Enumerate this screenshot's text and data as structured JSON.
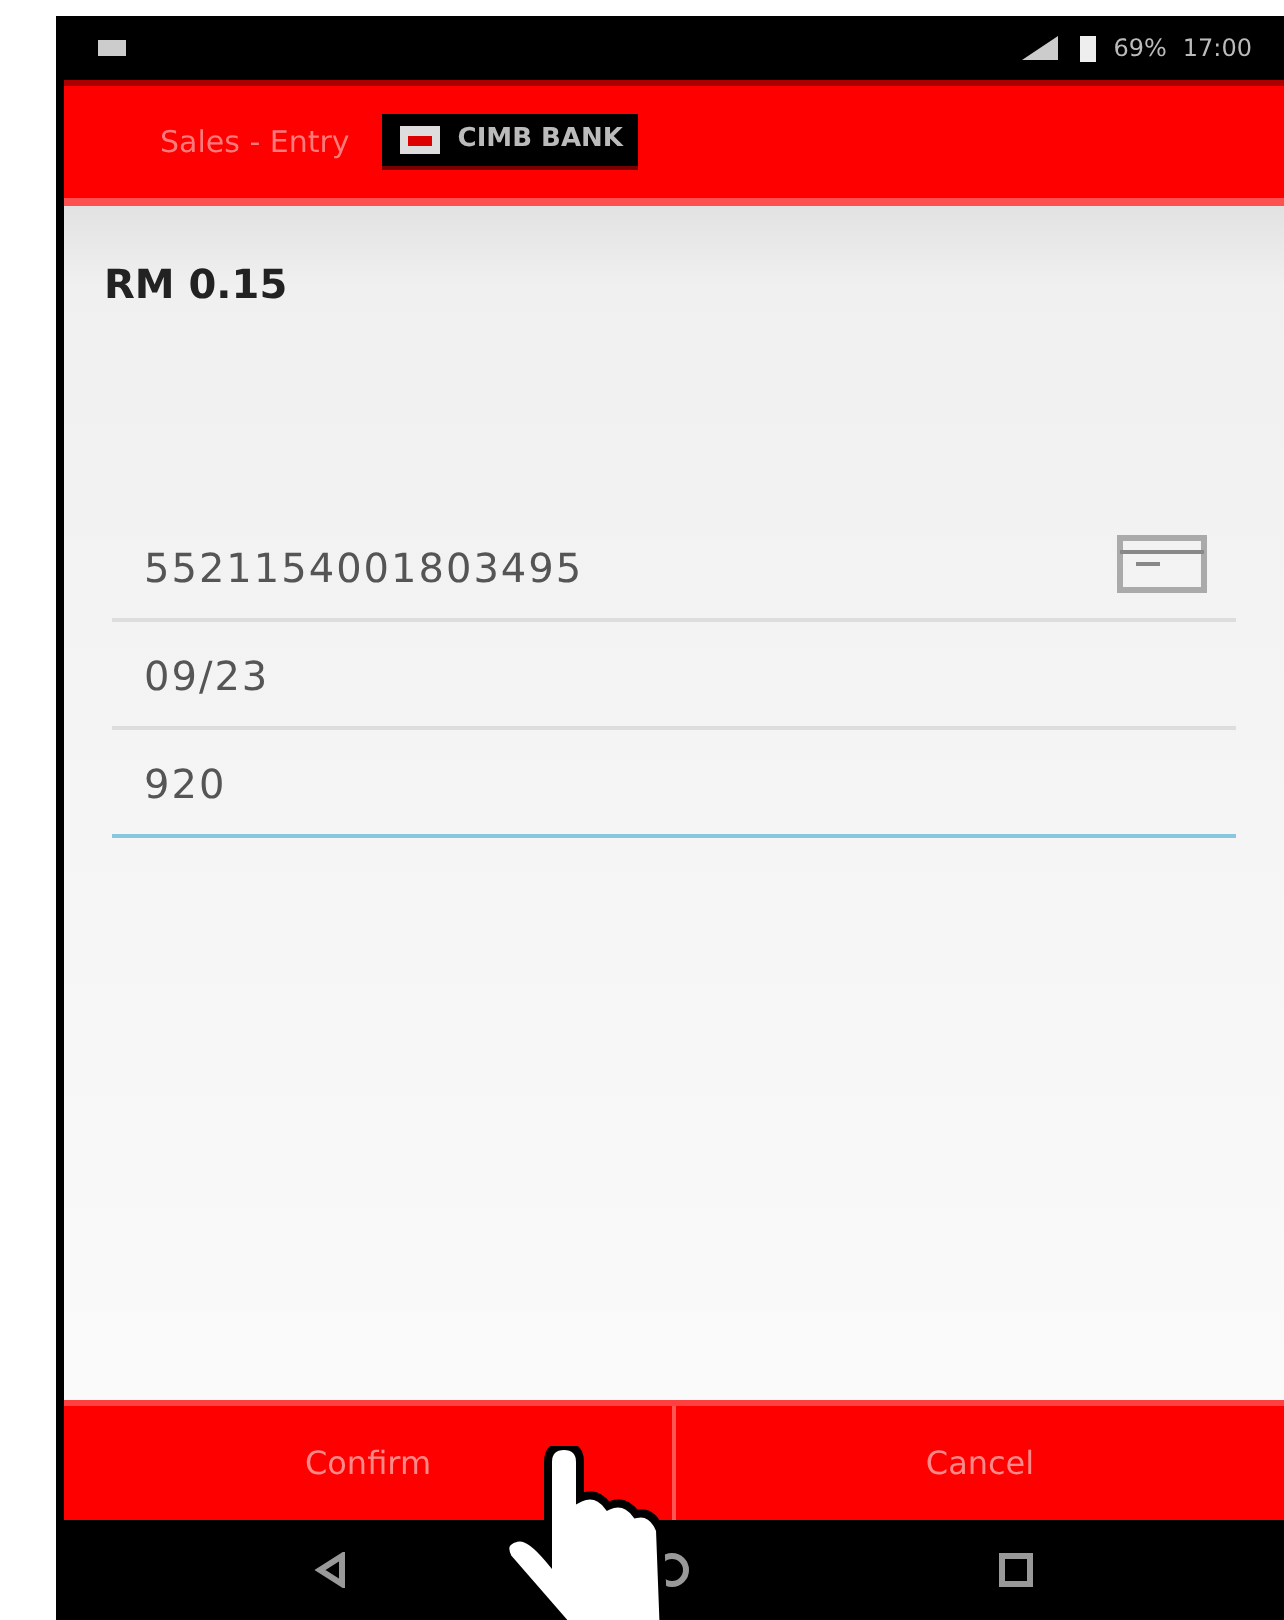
{
  "status_bar": {
    "battery": "69%",
    "time": "17:00"
  },
  "header": {
    "title": "Sales - Entry",
    "bank": "CIMB BANK"
  },
  "amount": "RM 0.15",
  "fields": [
    {
      "value": "5521154001803495",
      "focused": false,
      "card_icon": true
    },
    {
      "value": "09/23",
      "focused": false,
      "card_icon": false
    },
    {
      "value": "920",
      "focused": true,
      "card_icon": false
    }
  ],
  "buttons": [
    {
      "label": "Confirm"
    },
    {
      "label": "Cancel"
    }
  ]
}
